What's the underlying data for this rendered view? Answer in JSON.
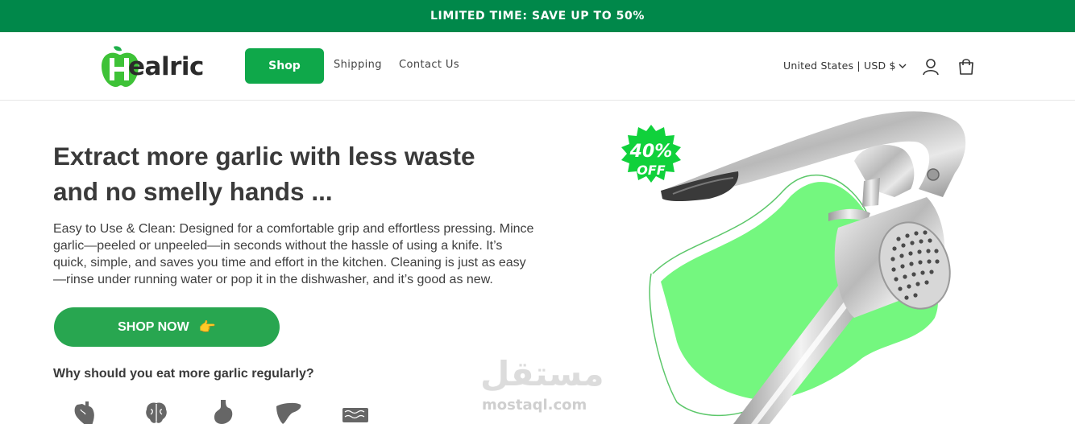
{
  "announcement": {
    "text": "LIMITED TIME: SAVE UP TO 50%"
  },
  "header": {
    "logo_text": "ealric",
    "logo_letter": "H",
    "nav": {
      "shop": "Shop",
      "shipping": "Shipping",
      "contact": "Contact Us"
    },
    "locale": "United States | USD $",
    "icons": [
      "chevron-down-icon",
      "account-icon",
      "cart-icon"
    ]
  },
  "hero": {
    "headline_line1": "Extract more garlic with less waste",
    "headline_line2": "and no smelly hands ...",
    "description": "Easy to Use & Clean: Designed for a comfortable grip and effortless pressing. Mince garlic—peeled or unpeeled—in seconds without the hassle of using a knife. It’s quick, simple, and saves you time and effort in the kitchen. Cleaning is just as easy—rinse under running water or pop it in the dishwasher, and it’s good as new.",
    "cta_label": "SHOP NOW",
    "cta_icon": "👉",
    "badge_percent": "40%",
    "badge_off": "OFF"
  },
  "benefits": {
    "title": "Why should you eat more garlic regularly?",
    "icons": [
      "heart-icon",
      "brain-icon",
      "stomach-icon",
      "liver-icon",
      "intestine-icon"
    ]
  },
  "watermark": {
    "arabic": "مستقل",
    "latin": "mostaql.com"
  },
  "colors": {
    "brand_green": "#00884a",
    "button_green": "#0fa84a",
    "cta_green": "#28a650",
    "blob_green": "#74f77f"
  }
}
